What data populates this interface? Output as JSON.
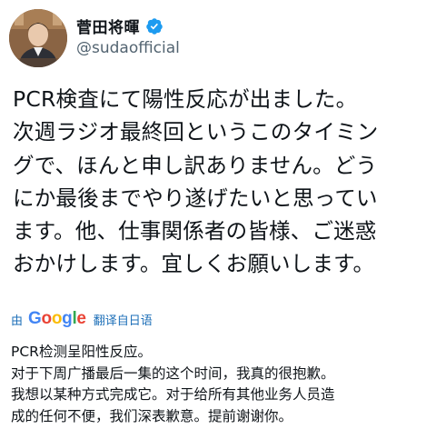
{
  "user": {
    "display_name": "菅田将暉",
    "handle": "@sudaofficial"
  },
  "tweet_lines": [
    "PCR検査にて陽性反応が出ました。",
    "次週ラジオ最終回というこのタイミン",
    "グで、ほんと申し訳ありません。どう",
    "にか最後までやり遂げたいと思ってい",
    "ます。他、仕事関係者の皆様、ご迷惑",
    "おかけします。宜しくお願いします。"
  ],
  "translate": {
    "by_label": "由",
    "provider_letters": [
      "G",
      "o",
      "o",
      "g",
      "l",
      "e"
    ],
    "link_label": "翻译自日语"
  },
  "translation_lines": [
    "PCR检测呈阳性反应。",
    "对于下周广播最后一集的这个时间，我真的很抱歉。",
    "我想以某种方式完成它。对于给所有其他业务人员造",
    "成的任何不便，我们深表歉意。提前谢谢你。"
  ],
  "icons": {
    "avatar": "profile-photo",
    "verified": "verified-badge-icon"
  },
  "colors": {
    "verified_blue": "#1d9bf0",
    "link_blue": "#1d6fb8",
    "handle_gray": "#536471"
  }
}
